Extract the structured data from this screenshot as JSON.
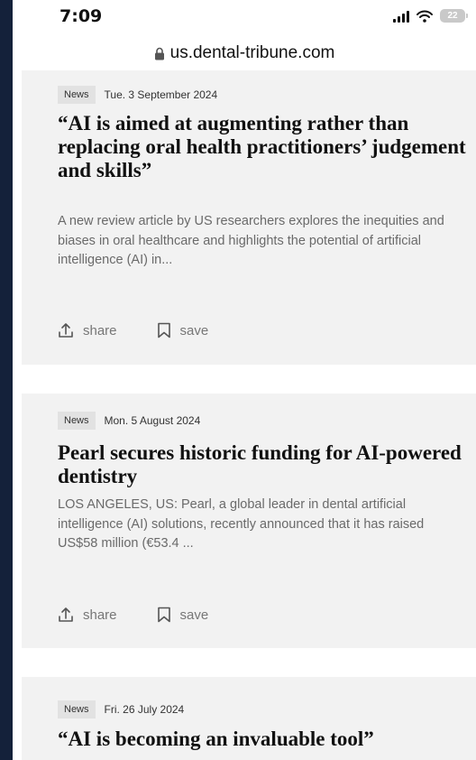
{
  "status_bar": {
    "time": "7:09",
    "battery": "22"
  },
  "browser": {
    "url": "us.dental-tribune.com"
  },
  "articles": [
    {
      "category": "News",
      "date": "Tue. 3 September 2024",
      "title": "“AI is aimed at augmenting rather than replacing oral health practitioners’ judgement and skills”",
      "excerpt": "A new review article by US researchers explores the inequities and biases in oral healthcare and highlights the potential of artificial intelligence (AI) in...",
      "share_label": "share",
      "save_label": "save"
    },
    {
      "category": "News",
      "date": "Mon. 5 August 2024",
      "title": "Pearl secures historic funding for AI-powered dentistry",
      "excerpt": "LOS ANGELES, US: Pearl, a global leader in dental artificial intelligence (AI) solutions, recently announced that it has raised US$58 million (€53.4 ...",
      "share_label": "share",
      "save_label": "save"
    },
    {
      "category": "News",
      "date": "Fri. 26 July 2024",
      "title": "“AI is becoming an invaluable tool”"
    }
  ],
  "colors": {
    "page_background": "#14213a",
    "card_background": "#f2f2f2",
    "badge_background": "#e2e2e2"
  },
  "icons": [
    "lock-icon",
    "signal-icon",
    "wifi-icon",
    "battery-icon",
    "share-icon",
    "bookmark-icon"
  ]
}
